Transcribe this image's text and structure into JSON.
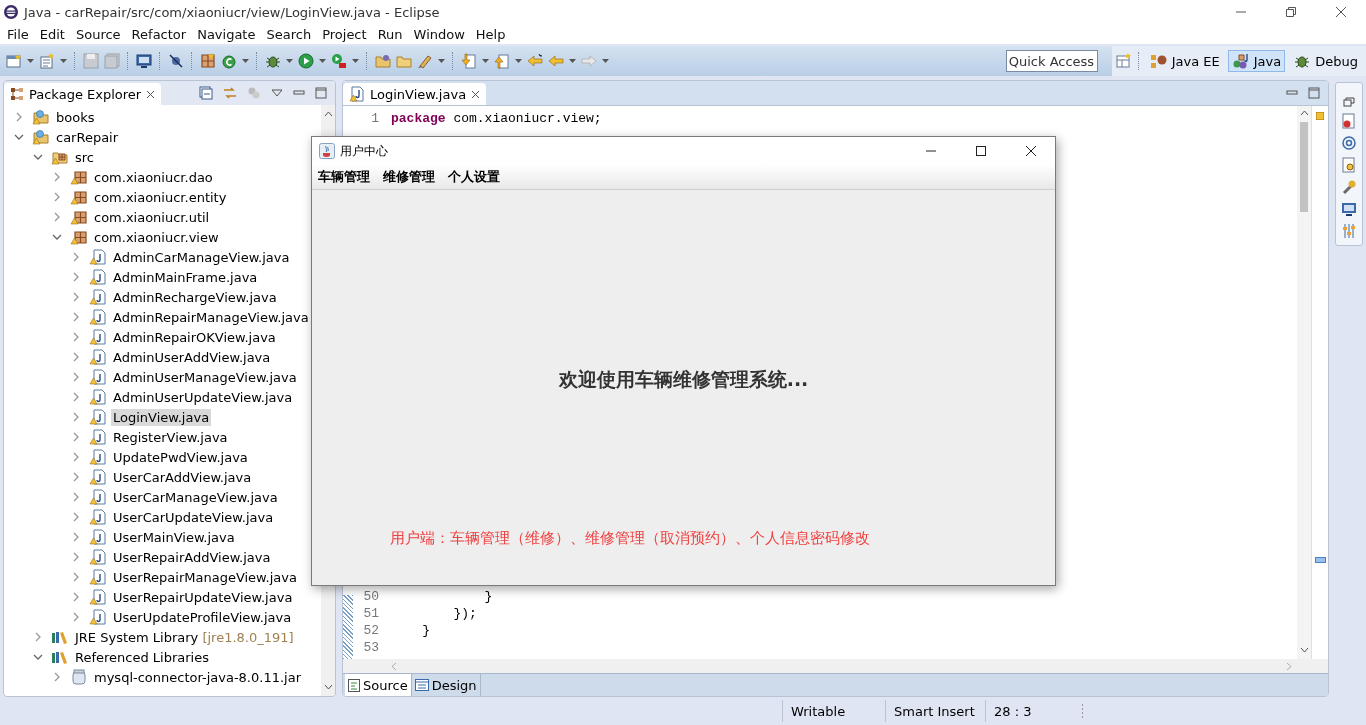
{
  "window": {
    "title": "Java - carRepair/src/com/xiaoniucr/view/LoginView.java - Eclipse"
  },
  "menu": [
    "File",
    "Edit",
    "Source",
    "Refactor",
    "Navigate",
    "Search",
    "Project",
    "Run",
    "Window",
    "Help"
  ],
  "quick_access": {
    "placeholder": "Quick Access"
  },
  "perspectives": [
    {
      "label": "Java EE",
      "selected": false
    },
    {
      "label": "Java",
      "selected": true
    },
    {
      "label": "Debug",
      "selected": false
    }
  ],
  "package_explorer": {
    "title": "Package Explorer",
    "tree": [
      {
        "label": "books",
        "kind": "project",
        "expanded": false,
        "selected": false
      },
      {
        "label": "carRepair",
        "kind": "project",
        "expanded": true,
        "selected": false,
        "children": [
          {
            "label": "src",
            "kind": "source-folder",
            "expanded": true,
            "selected": false,
            "children": [
              {
                "label": "com.xiaoniucr.dao",
                "kind": "package",
                "expanded": false,
                "selected": false
              },
              {
                "label": "com.xiaoniucr.entity",
                "kind": "package",
                "expanded": false,
                "selected": false
              },
              {
                "label": "com.xiaoniucr.util",
                "kind": "package",
                "expanded": false,
                "selected": false
              },
              {
                "label": "com.xiaoniucr.view",
                "kind": "package",
                "expanded": true,
                "selected": false,
                "children": [
                  {
                    "label": "AdminCarManageView.java",
                    "kind": "java-file",
                    "expanded": false,
                    "selected": false
                  },
                  {
                    "label": "AdminMainFrame.java",
                    "kind": "java-file",
                    "expanded": false,
                    "selected": false
                  },
                  {
                    "label": "AdminRechargeView.java",
                    "kind": "java-file",
                    "expanded": false,
                    "selected": false
                  },
                  {
                    "label": "AdminRepairManageView.java",
                    "kind": "java-file",
                    "expanded": false,
                    "selected": false
                  },
                  {
                    "label": "AdminRepairOKView.java",
                    "kind": "java-file",
                    "expanded": false,
                    "selected": false
                  },
                  {
                    "label": "AdminUserAddView.java",
                    "kind": "java-file",
                    "expanded": false,
                    "selected": false
                  },
                  {
                    "label": "AdminUserManageView.java",
                    "kind": "java-file",
                    "expanded": false,
                    "selected": false
                  },
                  {
                    "label": "AdminUserUpdateView.java",
                    "kind": "java-file",
                    "expanded": false,
                    "selected": false
                  },
                  {
                    "label": "LoginView.java",
                    "kind": "java-file",
                    "expanded": false,
                    "selected": true
                  },
                  {
                    "label": "RegisterView.java",
                    "kind": "java-file",
                    "expanded": false,
                    "selected": false
                  },
                  {
                    "label": "UpdatePwdView.java",
                    "kind": "java-file",
                    "expanded": false,
                    "selected": false
                  },
                  {
                    "label": "UserCarAddView.java",
                    "kind": "java-file",
                    "expanded": false,
                    "selected": false
                  },
                  {
                    "label": "UserCarManageView.java",
                    "kind": "java-file",
                    "expanded": false,
                    "selected": false
                  },
                  {
                    "label": "UserCarUpdateView.java",
                    "kind": "java-file",
                    "expanded": false,
                    "selected": false
                  },
                  {
                    "label": "UserMainView.java",
                    "kind": "java-file",
                    "expanded": false,
                    "selected": false
                  },
                  {
                    "label": "UserRepairAddView.java",
                    "kind": "java-file",
                    "expanded": false,
                    "selected": false
                  },
                  {
                    "label": "UserRepairManageView.java",
                    "kind": "java-file",
                    "expanded": false,
                    "selected": false
                  },
                  {
                    "label": "UserRepairUpdateView.java",
                    "kind": "java-file",
                    "expanded": false,
                    "selected": false
                  },
                  {
                    "label": "UserUpdateProfileView.java",
                    "kind": "java-file",
                    "expanded": false,
                    "selected": false
                  }
                ]
              }
            ]
          },
          {
            "label": "JRE System Library",
            "detail": "[jre1.8.0_191]",
            "kind": "library",
            "expanded": false,
            "selected": false
          },
          {
            "label": "Referenced Libraries",
            "kind": "library",
            "expanded": true,
            "selected": false,
            "children": [
              {
                "label": "mysql-connector-java-8.0.11.jar",
                "kind": "jar",
                "expanded": false,
                "selected": false
              }
            ]
          }
        ]
      }
    ]
  },
  "editor": {
    "tab": {
      "label": "LoginView.java",
      "selected": true
    },
    "lines_top": [
      {
        "number": "1",
        "code": "**package** com.xiaoniucr.view;"
      }
    ],
    "lines_bottom": [
      {
        "number": "50",
        "code": "            }"
      },
      {
        "number": "51",
        "code": "        });"
      },
      {
        "number": "52",
        "code": "    }"
      },
      {
        "number": "53"
      }
    ],
    "bottom_tabs": [
      {
        "label": "Source",
        "selected": true
      },
      {
        "label": "Design",
        "selected": false
      }
    ]
  },
  "dialog": {
    "title": "用户中心",
    "menu": [
      "车辆管理",
      "维修管理",
      "个人设置"
    ],
    "welcome": "欢迎使用车辆维修管理系统...",
    "note": "用户端：车辆管理（维修）、维修管理（取消预约）、个人信息密码修改"
  },
  "status_bar": [
    "Writable",
    "Smart Insert",
    "28 : 3"
  ]
}
